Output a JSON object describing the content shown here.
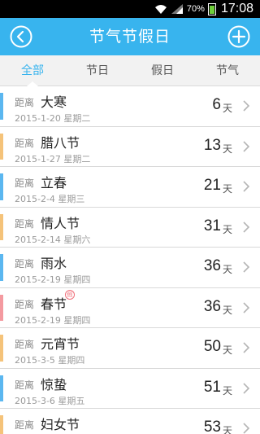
{
  "status": {
    "battery_pct": "70%",
    "time": "17:08",
    "battery_level": 0.7
  },
  "header": {
    "title": "节气节假日",
    "back_icon": "back-circle-icon",
    "add_icon": "add-circle-icon"
  },
  "tabs": [
    {
      "label": "全部",
      "active": true
    },
    {
      "label": "节日",
      "active": false
    },
    {
      "label": "假日",
      "active": false
    },
    {
      "label": "节气",
      "active": false
    }
  ],
  "prefix_label": "距离",
  "unit_label": "天",
  "items": [
    {
      "name": "大寒",
      "date": "2015-1-20 星期二",
      "days": "6",
      "color": "#5bb7f0"
    },
    {
      "name": "腊八节",
      "date": "2015-1-27 星期二",
      "days": "13",
      "color": "#f5c37a"
    },
    {
      "name": "立春",
      "date": "2015-2-4 星期三",
      "days": "21",
      "color": "#5bb7f0"
    },
    {
      "name": "情人节",
      "date": "2015-2-14 星期六",
      "days": "31",
      "color": "#f5c37a"
    },
    {
      "name": "雨水",
      "date": "2015-2-19 星期四",
      "days": "36",
      "color": "#5bb7f0"
    },
    {
      "name": "春节",
      "date": "2015-2-19 星期四",
      "days": "36",
      "color": "#f49aa0",
      "badge": "假"
    },
    {
      "name": "元宵节",
      "date": "2015-3-5 星期四",
      "days": "50",
      "color": "#f5c37a"
    },
    {
      "name": "惊蛰",
      "date": "2015-3-6 星期五",
      "days": "51",
      "color": "#5bb7f0"
    },
    {
      "name": "妇女节",
      "date": "",
      "days": "53",
      "color": "#f5c37a"
    }
  ],
  "colors": {
    "accent": "#38b4ee",
    "solar_term": "#5bb7f0",
    "festival": "#f5c37a",
    "holiday": "#f49aa0"
  }
}
